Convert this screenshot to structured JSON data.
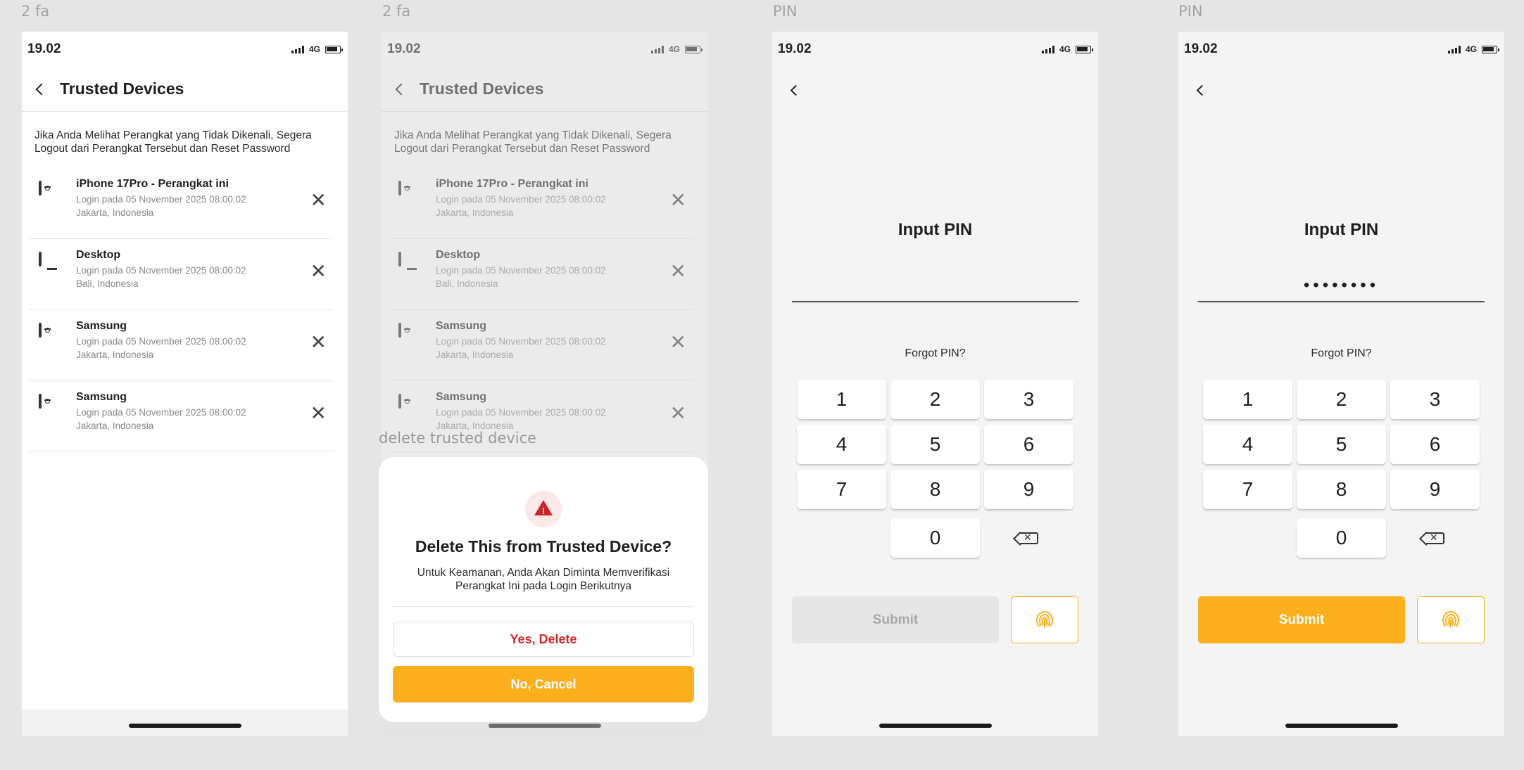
{
  "frames": [
    {
      "label": "2 fa"
    },
    {
      "label": "2 fa"
    },
    {
      "label": "PIN"
    },
    {
      "label": "PIN"
    }
  ],
  "status": {
    "time": "19.02",
    "network": "4G"
  },
  "trusted": {
    "title": "Trusted Devices",
    "notice": "Jika Anda Melihat Perangkat yang Tidak Dikenali, Segera Logout dari Perangkat Tersebut dan Reset Password",
    "devices": [
      {
        "name": "iPhone 17Pro - Perangkat ini",
        "login": "Login pada 05 November 2025 08:00:02",
        "location": "Jakarta, Indonesia",
        "icon": "phone-icon"
      },
      {
        "name": "Desktop",
        "login": "Login pada 05 November 2025 08:00:02",
        "location": "Bali, Indonesia",
        "icon": "desktop-icon"
      },
      {
        "name": "Samsung",
        "login": "Login pada 05 November 2025 08:00:02",
        "location": "Jakarta, Indonesia",
        "icon": "phone-icon"
      },
      {
        "name": "Samsung",
        "login": "Login pada 05 November 2025 08:00:02",
        "location": "Jakarta, Indonesia",
        "icon": "phone-icon"
      }
    ],
    "close_glyph": "✕"
  },
  "dialog": {
    "frame_label": "delete trusted device",
    "title": "Delete This from Trusted Device?",
    "subtitle": "Untuk Keamanan, Anda Akan Diminta Memverifikasi Perangkat Ini pada Login Berikutnya",
    "confirm_label": "Yes, Delete",
    "cancel_label": "No, Cancel",
    "icon": "warning-icon"
  },
  "pin": {
    "title": "Input PIN",
    "forgot_label": "Forgot PIN?",
    "masked_value": "••••••••",
    "keys": [
      "1",
      "2",
      "3",
      "4",
      "5",
      "6",
      "7",
      "8",
      "9",
      "0"
    ],
    "submit_label": "Submit"
  },
  "colors": {
    "accent": "#fbaf1c",
    "danger": "#d02a2a",
    "disabled": "#e6e6e6"
  }
}
